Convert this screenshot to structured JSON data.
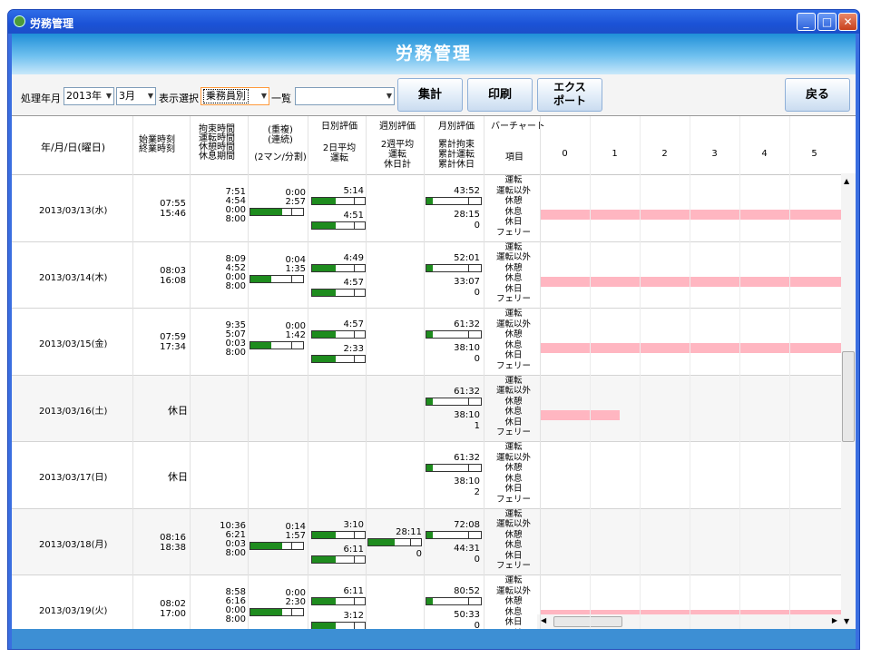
{
  "window": {
    "title": "労務管理",
    "header_title": "労務管理"
  },
  "toolbar": {
    "year_label": "処理年月",
    "year_value": "2013年",
    "month_value": "3月",
    "display_label": "表示選択",
    "display_value": "乗務員別",
    "list_label": "一覧",
    "list_value": "",
    "aggregate_label": "集計",
    "print_label": "印刷",
    "export_label_1": "エクス",
    "export_label_2": "ポート",
    "back_label": "戻る"
  },
  "grid_header": {
    "date_col": "年/月/日(曜日)",
    "start_end_1": "始業時刻",
    "start_end_2": "終業時刻",
    "times_1": "拘束時間",
    "times_2": "運転時間",
    "times_3": "休憩時間",
    "times_4": "休息期間",
    "overlap_1": "(重複)",
    "overlap_2": "(連続)",
    "overlap_3": "(2マン/分割)",
    "daily_eval": "日別評価",
    "daily_sub_1": "2日平均",
    "daily_sub_2": "運転",
    "weekly_eval": "週別評価",
    "weekly_sub_1": "2週平均",
    "weekly_sub_2": "運転",
    "weekly_sub_3": "休日計",
    "monthly_eval": "月別評価",
    "monthly_sub_1": "累計拘束",
    "monthly_sub_2": "累計運転",
    "monthly_sub_3": "累計休日",
    "barchart": "バーチャート",
    "item_col": "項目",
    "hours": [
      "0",
      "1",
      "2",
      "3",
      "4",
      "5"
    ]
  },
  "item_labels": [
    "運転",
    "運転以外",
    "休憩",
    "休息",
    "休日",
    "フェリー"
  ],
  "rows": [
    {
      "date": "2013/03/13(水)",
      "start": "07:55",
      "end": "15:46",
      "t1": "7:51",
      "t2": "4:54",
      "t3": "0:00",
      "t4": "8:00",
      "o1": "0:00",
      "o2": "2:57",
      "d1": "5:14",
      "d2": "4:51",
      "w1": "",
      "w2": "",
      "m1": "43:52",
      "m2": "28:15",
      "m3": "0",
      "pink": 1.0,
      "green_ratio": 0.6
    },
    {
      "date": "2013/03/14(木)",
      "start": "08:03",
      "end": "16:08",
      "t1": "8:09",
      "t2": "4:52",
      "t3": "0:00",
      "t4": "8:00",
      "o1": "0:04",
      "o2": "1:35",
      "d1": "4:49",
      "d2": "4:57",
      "w1": "",
      "w2": "",
      "m1": "52:01",
      "m2": "33:07",
      "m3": "0",
      "pink": 1.0,
      "green_ratio": 0.4
    },
    {
      "date": "2013/03/15(金)",
      "start": "07:59",
      "end": "17:34",
      "t1": "9:35",
      "t2": "5:07",
      "t3": "0:03",
      "t4": "8:00",
      "o1": "0:00",
      "o2": "1:42",
      "d1": "4:57",
      "d2": "2:33",
      "w1": "",
      "w2": "",
      "m1": "61:32",
      "m2": "38:10",
      "m3": "0",
      "pink": 1.0,
      "green_ratio": 0.4
    },
    {
      "date": "2013/03/16(土)",
      "start": "休日",
      "end": "",
      "t1": "",
      "t2": "",
      "t3": "",
      "t4": "",
      "o1": "",
      "o2": "",
      "d1": "",
      "d2": "",
      "w1": "",
      "w2": "",
      "m1": "61:32",
      "m2": "38:10",
      "m3": "1",
      "pink": 0.26,
      "green_ratio": 0
    },
    {
      "date": "2013/03/17(日)",
      "start": "休日",
      "end": "",
      "t1": "",
      "t2": "",
      "t3": "",
      "t4": "",
      "o1": "",
      "o2": "",
      "d1": "",
      "d2": "",
      "w1": "",
      "w2": "",
      "m1": "61:32",
      "m2": "38:10",
      "m3": "2",
      "pink": 0,
      "green_ratio": 0
    },
    {
      "date": "2013/03/18(月)",
      "start": "08:16",
      "end": "18:38",
      "t1": "10:36",
      "t2": "6:21",
      "t3": "0:03",
      "t4": "8:00",
      "o1": "0:14",
      "o2": "1:57",
      "d1": "3:10",
      "d2": "6:11",
      "w1": "28:11",
      "w2": "0",
      "m1": "72:08",
      "m2": "44:31",
      "m3": "0",
      "pink": 0,
      "green_ratio": 0.6
    },
    {
      "date": "2013/03/19(火)",
      "start": "08:02",
      "end": "17:00",
      "t1": "8:58",
      "t2": "6:16",
      "t3": "0:00",
      "t4": "8:00",
      "o1": "0:00",
      "o2": "2:30",
      "d1": "6:11",
      "d2": "3:12",
      "w1": "",
      "w2": "",
      "m1": "80:52",
      "m2": "50:33",
      "m3": "0",
      "pink": 1.0,
      "green_ratio": 0.6
    }
  ]
}
